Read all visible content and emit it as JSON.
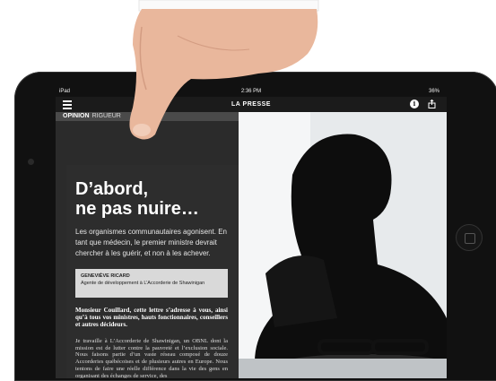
{
  "status_bar": {
    "carrier": "iPad",
    "time": "2:36 PM",
    "battery": "36%"
  },
  "app": {
    "name": "LA PRESSE"
  },
  "section": {
    "name": "OPINION",
    "sub": "RIGUEUR"
  },
  "article": {
    "headline_line1": "D’abord,",
    "headline_line2": "ne pas nuire…",
    "standfirst": "Les organismes communautaires agonisent. En tant que médecin, le premier ministre devrait chercher à les guérir, et non à les achever.",
    "author_name": "GENEVIÈVE RICARD",
    "author_role": "Agente de développement à L’Accorderie de Shawinigan",
    "lede": "Monsieur Couillard, cette lettre s’adresse à vous, ainsi qu’à tous vos ministres, hauts fonctionnaires, conseillers et autres décideurs.",
    "body": "Je travaille à L’Accorderie de Shawinigan, un OBNL dont la mission est de lutter contre la pauvreté et l’exclusion sociale. Nous faisons partie d’un vaste réseau composé de douze Accorderies québécoises et de plusieurs autres en Europe. Nous tentons de faire une réelle différence dans la vie des gens en organisant des échanges de service, des"
  },
  "icons": {
    "menu": "hamburger-icon",
    "info": "info-icon",
    "share": "share-icon"
  },
  "colors": {
    "screen_bg": "#2b2b2b",
    "appbar_bg": "#1b1b1b",
    "author_box": "#d9d9d9"
  }
}
